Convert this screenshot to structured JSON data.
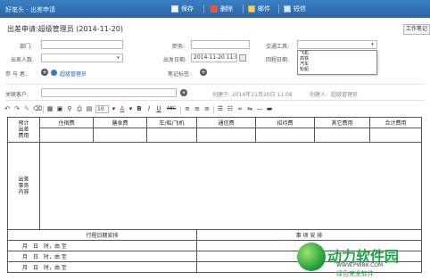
{
  "app": {
    "title": "好笔头 - 出差申请",
    "toolbar": [
      {
        "label": "保存",
        "icon": "save-icon"
      },
      {
        "label": "删除",
        "icon": "delete-icon"
      },
      {
        "label": "邮件",
        "icon": "mail-icon"
      },
      {
        "label": "短信",
        "icon": "sms-icon"
      }
    ]
  },
  "heading": "出差申请:超级管理员 (2014-11-20)",
  "work_notes_button": "工作笔记",
  "form": {
    "department_label": "部门:",
    "department_value": "",
    "position_label": "职务:",
    "position_value": "",
    "transport_label": "交通工具:",
    "transport_value": "",
    "transport_options": [
      "飞机",
      "高铁",
      "汽车",
      "轮船"
    ],
    "people_label": "出差人数:",
    "people_value": "",
    "depart_date_label": "出发日期:",
    "depart_date_value": "2014-11-20 11:08",
    "return_date_label": "回程日期:",
    "participants_label": "参 与 者:",
    "participant_name": "超级管理员",
    "note_tags_label": "笔记标签:",
    "customer_label": "关联客户:",
    "customer_value": "",
    "created_label": "创建于: 2014年11月20日 11:08",
    "creator_label": "创建人:",
    "creator_name": "超级管理员"
  },
  "editor_toolbar": {
    "font_size": "10",
    "bold": "B",
    "italic": "I",
    "underline": "U",
    "strike": "ABC"
  },
  "table": {
    "budget_label": "预计出差费用",
    "headers": [
      "住宿费",
      "膳食费",
      "车/船/飞机",
      "通信费",
      "招待费",
      "其它费用",
      "合计费用"
    ],
    "items_label": "出差事务内容",
    "schedule_header": "行程日期安排",
    "matters_header": "事 项 安 排",
    "schedule_rows": [
      "月　日　时，由 至",
      "月　日　时，由 至",
      "月　日　时，由 至"
    ]
  },
  "watermark": {
    "name": "动力软件园",
    "url": "WWW.PW88.COM",
    "slogan": "绿色安全软件"
  },
  "colors": {
    "titlebar": "#2a66a8",
    "link": "#2a5fb0",
    "watermark_green": "#21a347"
  }
}
